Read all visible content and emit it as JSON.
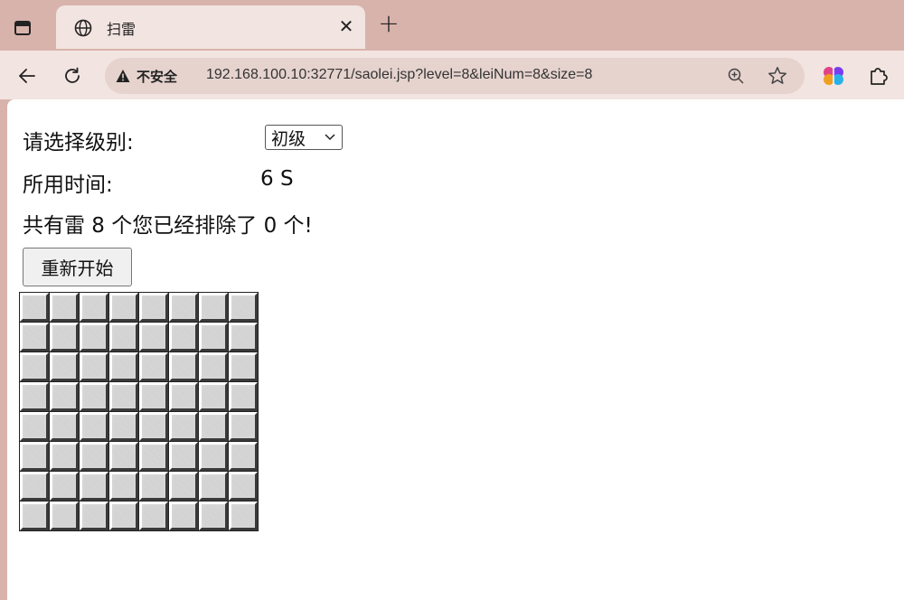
{
  "browser": {
    "tab": {
      "title": "扫雷",
      "favicon_icon": "globe-icon",
      "close_icon": "close-icon"
    },
    "new_tab_icon": "plus-icon",
    "toolbar": {
      "back_icon": "arrow-left-icon",
      "reload_icon": "reload-icon",
      "security_label": "不安全",
      "security_icon": "warning-triangle-icon",
      "url": "192.168.100.10:32771/saolei.jsp?level=8&leiNum=8&size=8",
      "zoom_icon": "zoom-in-icon",
      "bookmark_icon": "star-icon",
      "extension_icons": [
        "brain-extension-icon",
        "puzzle-extension-icon"
      ]
    },
    "colors": {
      "frame": "#d8b3ab",
      "tab_active": "#f2e4e0",
      "omnibox": "#e6d3ce"
    }
  },
  "game": {
    "level_label": "请选择级别:",
    "level_selected": "初级",
    "time_label": "所用时间:",
    "time_value": "6 S",
    "status": "共有雷 8 个您已经排除了 0 个!",
    "restart_label": "重新开始",
    "grid": {
      "rows": 8,
      "cols": 8,
      "state": "all-unrevealed"
    }
  }
}
